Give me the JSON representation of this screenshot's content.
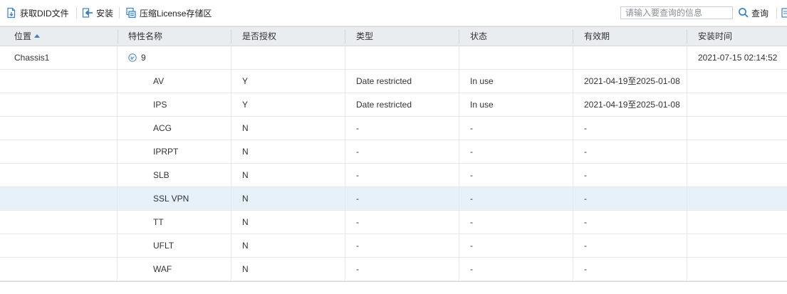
{
  "toolbar": {
    "get_did_label": "获取DID文件",
    "install_label": "安装",
    "compress_label": "压缩License存储区",
    "search_placeholder": "请输入要查询的信息",
    "search_label": "查询"
  },
  "table": {
    "columns": [
      "位置",
      "特性名称",
      "是否授权",
      "类型",
      "状态",
      "有效期",
      "安装时间"
    ],
    "sorted_column": "位置",
    "group": {
      "location": "Chassis1",
      "count": "9",
      "install_time": "2021-07-15 02:14:52"
    },
    "rows": [
      {
        "name": "AV",
        "licensed": "Y",
        "type": "Date restricted",
        "status": "In use",
        "validity": "2021-04-19至2025-01-08"
      },
      {
        "name": "IPS",
        "licensed": "Y",
        "type": "Date restricted",
        "status": "In use",
        "validity": "2021-04-19至2025-01-08"
      },
      {
        "name": "ACG",
        "licensed": "N",
        "type": "-",
        "status": "-",
        "validity": "-"
      },
      {
        "name": "IPRPT",
        "licensed": "N",
        "type": "-",
        "status": "-",
        "validity": "-"
      },
      {
        "name": "SLB",
        "licensed": "N",
        "type": "-",
        "status": "-",
        "validity": "-"
      },
      {
        "name": "SSL VPN",
        "licensed": "N",
        "type": "-",
        "status": "-",
        "validity": "-",
        "selected": true
      },
      {
        "name": "TT",
        "licensed": "N",
        "type": "-",
        "status": "-",
        "validity": "-"
      },
      {
        "name": "UFLT",
        "licensed": "N",
        "type": "-",
        "status": "-",
        "validity": "-"
      },
      {
        "name": "WAF",
        "licensed": "N",
        "type": "-",
        "status": "-",
        "validity": "-"
      }
    ]
  },
  "colors": {
    "accent": "#2f7fd1",
    "header_bg": "#eaedf0",
    "selected_row": "#e6f1f9"
  },
  "icons": {
    "get_did": "file-download-icon",
    "install": "install-arrow-icon",
    "compress": "compress-icon",
    "search": "search-icon",
    "expand": "collapse-chevron-icon"
  }
}
